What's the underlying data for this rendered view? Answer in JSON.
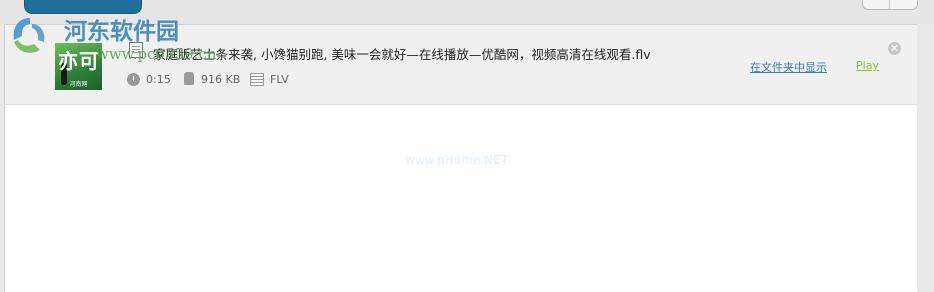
{
  "item": {
    "title": "家庭版艺士条来袭, 小馋猫别跑, 美味一会就好—在线播放—优酷网，视频高清在线观看.flv",
    "duration": "0:15",
    "size": "916 KB",
    "format": "FLV",
    "show_in_folder_label": "在文件夹中显示",
    "play_label": "Play",
    "close_glyph": "×",
    "thumbnail": {
      "big_text": "亦可",
      "small_text": "河南网"
    }
  },
  "watermark": {
    "title": "河东软件园",
    "url": "www.pc0359.cn",
    "faint_text": "www.pHome.NET"
  },
  "colors": {
    "link_blue": "#3a7bbf",
    "play_green": "#8cbf3a",
    "tab_blue": "#1f6f9a",
    "watermark_blue": "#2f7fb8",
    "watermark_green": "#4aa24a"
  },
  "icons": [
    "file-icon",
    "clock-icon",
    "weight-icon",
    "film-icon",
    "close-icon"
  ]
}
